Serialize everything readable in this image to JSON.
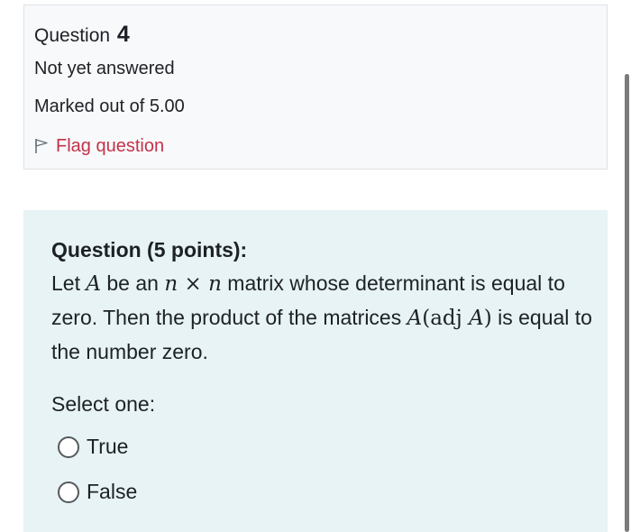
{
  "info": {
    "question_label": "Question",
    "question_number": "4",
    "state": "Not yet answered",
    "grade": "Marked out of 5.00",
    "flag_label": "Flag question"
  },
  "question": {
    "title": "Question (5 points):",
    "text": {
      "p1": "Let ",
      "var_a": "A",
      "p2": " be an ",
      "var_n1": "n",
      "times": " × ",
      "var_n2": "n",
      "p3": " matrix whose determinant is equal to zero. Then the product of the matrices ",
      "math_a": "A",
      "math_open": "(adj ",
      "math_a2": "A",
      "math_close": ")",
      "p4": " is equal to the number zero."
    },
    "prompt": "Select one:",
    "options": [
      {
        "label": "True"
      },
      {
        "label": "False"
      }
    ]
  },
  "colors": {
    "flag_text": "#c4314b",
    "content_background": "#e7f3f5",
    "info_background": "#f8f9fa"
  }
}
